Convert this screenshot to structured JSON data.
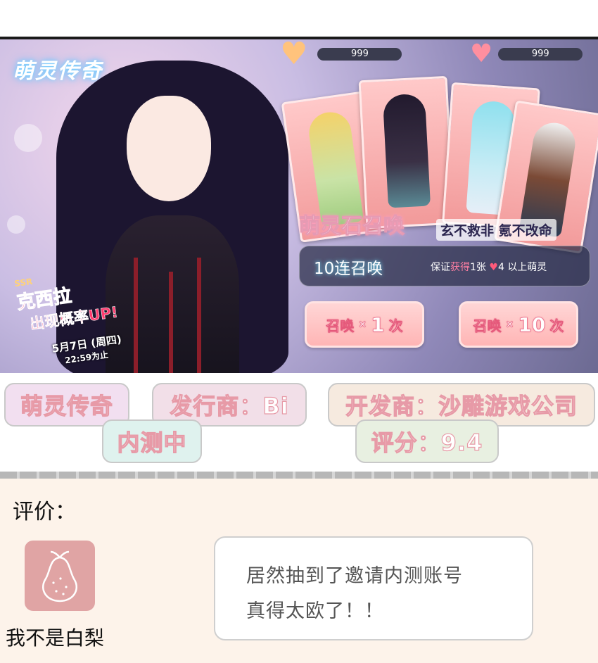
{
  "banner": {
    "game_logo": "萌灵传奇",
    "promo": {
      "rarity": "SSR",
      "character_name": "克西拉",
      "rate_up": "出现概率UP!",
      "date": "5月7日 (周四)",
      "until": "22:59为止"
    },
    "currency": [
      {
        "icon": "heart-orange-icon",
        "value": "999"
      },
      {
        "icon": "heart-pink-icon",
        "value": "999"
      }
    ],
    "summon_title": "萌灵石召唤",
    "summon_slogan": "玄不救非 氪不改命",
    "ten_pull": {
      "label": "10连召唤",
      "guarantee_prefix": "保证",
      "guarantee_em": "获得",
      "guarantee_mid": "1张",
      "guarantee_num": "4",
      "guarantee_suffix": "以上萌灵"
    },
    "buttons": [
      {
        "prefix": "召唤",
        "times": "×",
        "count": "1",
        "suffix": "次"
      },
      {
        "prefix": "召唤",
        "times": "×",
        "count": "10",
        "suffix": "次"
      }
    ],
    "colors": {
      "accent_pink": "#ff3b6e",
      "button_fill": "#ffc6c6",
      "panel_dark": "#2a2d46"
    }
  },
  "game_info": {
    "name": "萌灵传奇",
    "publisher": "发行商：Bi",
    "developer": "开发商：沙雕游戏公司",
    "status": "内测中",
    "rating": "评分：9.4"
  },
  "comments": {
    "title": "评价：",
    "items": [
      {
        "username": "我不是白梨",
        "avatar_icon": "pear-icon",
        "text_line1": "居然抽到了邀请内测账号",
        "text_line2": "真得太欧了！！"
      }
    ]
  }
}
